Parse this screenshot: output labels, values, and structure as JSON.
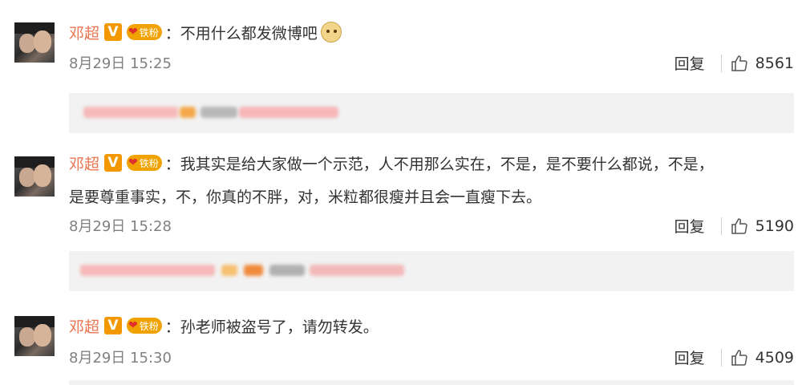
{
  "comments": [
    {
      "username": "邓超",
      "v_badge": "V",
      "fan_badge": "铁粉",
      "colon": "：",
      "text": "不用什么都发微博吧",
      "has_emoji": true,
      "emoji_icon": "doge-emoji-icon",
      "time": "8月29日 15:25",
      "reply_label": "回复",
      "likes": "8561"
    },
    {
      "username": "邓超",
      "v_badge": "V",
      "fan_badge": "铁粉",
      "colon": "：",
      "text": "我其实是给大家做一个示范，人不用那么实在，不是，是不要什么都说，不是，",
      "text_line2": "是要尊重事实，不，你真的不胖，对，米粒都很瘦并且会一直瘦下去。",
      "time": "8月29日 15:28",
      "reply_label": "回复",
      "likes": "5190"
    },
    {
      "username": "邓超",
      "v_badge": "V",
      "fan_badge": "铁粉",
      "colon": "：",
      "text": "孙老师被盗号了，请勿转发。",
      "time": "8月29日 15:30",
      "reply_label": "回复",
      "likes": "4509"
    }
  ],
  "colors": {
    "username": "#eb7350",
    "v_badge": "#f39800",
    "fan_badge": "#f0a300",
    "timestamp": "#808080",
    "subreply_bg": "#f2f2f2"
  }
}
